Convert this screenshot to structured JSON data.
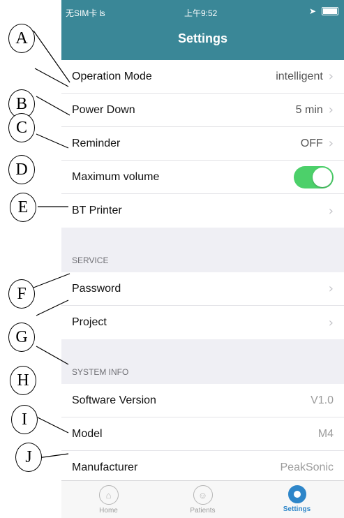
{
  "status_bar": {
    "carrier": "无SIM卡",
    "time": "上午9:52"
  },
  "nav": {
    "title": "Settings"
  },
  "section1": {
    "rows": [
      {
        "label": "Operation Mode",
        "value": "intelligent"
      },
      {
        "label": "Power Down",
        "value": "5 min"
      },
      {
        "label": "Reminder",
        "value": "OFF"
      },
      {
        "label": "Maximum volume",
        "toggle_on": true
      },
      {
        "label": "BT Printer",
        "value": ""
      }
    ]
  },
  "service": {
    "header": "SERVICE",
    "rows": [
      {
        "label": "Password"
      },
      {
        "label": "Project"
      }
    ]
  },
  "system_info": {
    "header": "SYSTEM INFO",
    "rows": [
      {
        "label": "Software Version",
        "value": "V1.0"
      },
      {
        "label": "Model",
        "value": "M4"
      },
      {
        "label": "Manufacturer",
        "value": "PeakSonic"
      }
    ]
  },
  "tabbar": {
    "tabs": [
      {
        "label": "Home",
        "icon": "bank-icon"
      },
      {
        "label": "Patients",
        "icon": "person-icon"
      },
      {
        "label": "Settings",
        "icon": "gear-icon",
        "active": true
      }
    ]
  },
  "callouts": [
    "A",
    "B",
    "C",
    "D",
    "E",
    "F",
    "G",
    "H",
    "I",
    "J"
  ],
  "colors": {
    "nav_bg": "#3a8797",
    "toggle_on": "#4cd06a",
    "active_tab": "#2e86c9"
  }
}
